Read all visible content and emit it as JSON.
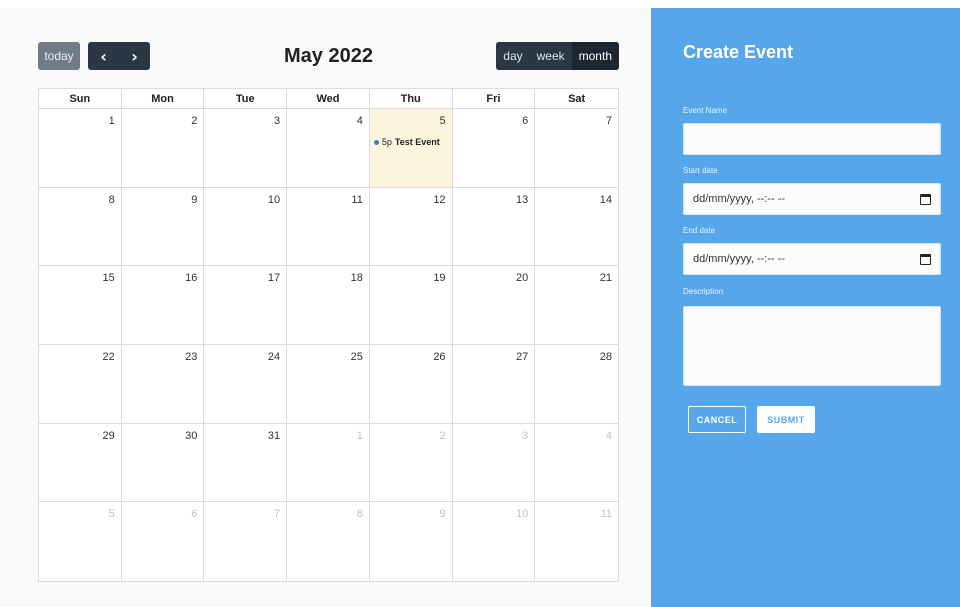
{
  "calendar": {
    "title": "May 2022",
    "today_label": "today",
    "prev_icon": "‹",
    "next_icon": "›",
    "views": [
      "day",
      "week",
      "month"
    ],
    "active_view": "month",
    "weekdays": [
      "Sun",
      "Mon",
      "Tue",
      "Wed",
      "Thu",
      "Fri",
      "Sat"
    ],
    "days": [
      {
        "n": "1"
      },
      {
        "n": "2"
      },
      {
        "n": "3"
      },
      {
        "n": "4"
      },
      {
        "n": "5",
        "today": true,
        "event_time": "5p",
        "event_title": "Test Event"
      },
      {
        "n": "6"
      },
      {
        "n": "7"
      },
      {
        "n": "8"
      },
      {
        "n": "9"
      },
      {
        "n": "10"
      },
      {
        "n": "11"
      },
      {
        "n": "12"
      },
      {
        "n": "13"
      },
      {
        "n": "14"
      },
      {
        "n": "15"
      },
      {
        "n": "16"
      },
      {
        "n": "17"
      },
      {
        "n": "18"
      },
      {
        "n": "19"
      },
      {
        "n": "20"
      },
      {
        "n": "21"
      },
      {
        "n": "22"
      },
      {
        "n": "23"
      },
      {
        "n": "24"
      },
      {
        "n": "25"
      },
      {
        "n": "26"
      },
      {
        "n": "27"
      },
      {
        "n": "28"
      },
      {
        "n": "29"
      },
      {
        "n": "30"
      },
      {
        "n": "31"
      },
      {
        "n": "1",
        "other": true
      },
      {
        "n": "2",
        "other": true
      },
      {
        "n": "3",
        "other": true
      },
      {
        "n": "4",
        "other": true
      },
      {
        "n": "5",
        "other": true
      },
      {
        "n": "6",
        "other": true
      },
      {
        "n": "7",
        "other": true
      },
      {
        "n": "8",
        "other": true
      },
      {
        "n": "9",
        "other": true
      },
      {
        "n": "10",
        "other": true
      },
      {
        "n": "11",
        "other": true
      }
    ],
    "colors": {
      "today_bg": "#fcf5de",
      "event_dot": "#3d7fc0",
      "toolbar_dark": "#2b3744"
    }
  },
  "form": {
    "title": "Create Event",
    "event_name_label": "Event Name",
    "event_name_value": "",
    "start_label": "Start date",
    "start_value": "dd/mm/yyyy, --:-- --",
    "end_label": "End date",
    "end_value": "dd/mm/yyyy, --:-- --",
    "description_label": "Description",
    "description_value": "",
    "cancel_label": "CANCEL",
    "submit_label": "SUBMIT",
    "panel_color": "#55a7ea"
  }
}
